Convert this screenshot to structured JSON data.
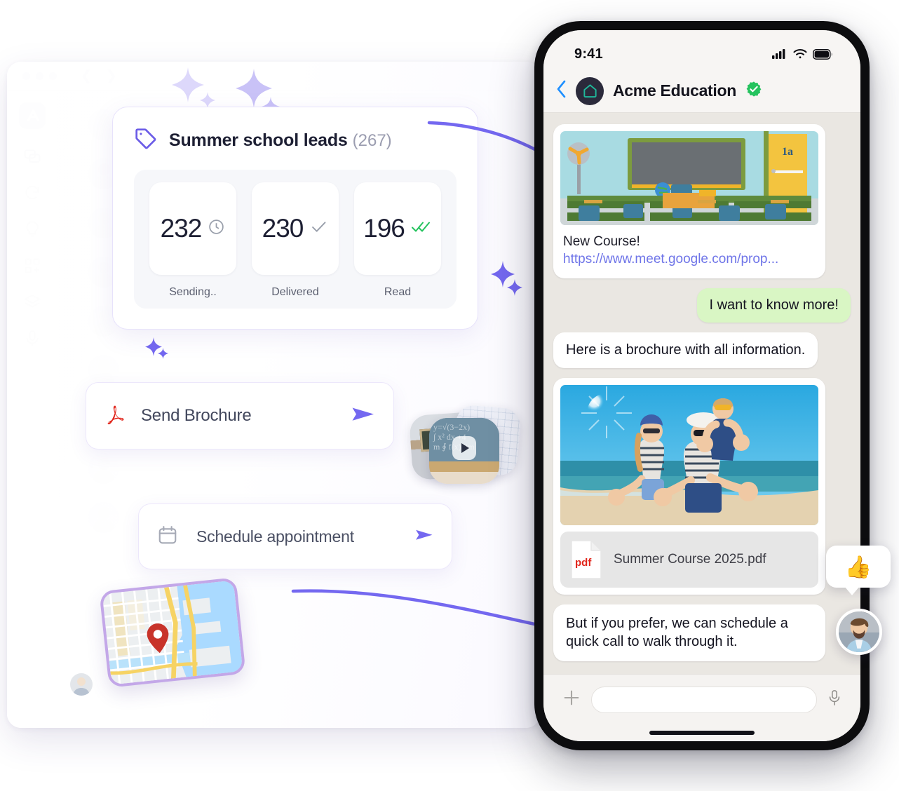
{
  "desktop": {
    "window_controls": [
      "close",
      "minimize",
      "maximize"
    ],
    "nav_back_icon": "chevron-left-icon",
    "nav_forward_icon": "chevron-right-icon",
    "rail": {
      "logo_icon": "app-logo-icon",
      "items": [
        {
          "icon": "chat-bubbles-icon",
          "name": "conversations"
        },
        {
          "icon": "refresh-sync-icon",
          "name": "sync"
        },
        {
          "icon": "lightbulb-icon",
          "name": "insights"
        },
        {
          "icon": "apps-add-icon",
          "name": "integrations"
        },
        {
          "icon": "layers-icon",
          "name": "layers"
        },
        {
          "icon": "microphone-icon",
          "name": "voice"
        }
      ]
    }
  },
  "stats_card": {
    "tag_icon": "tag-icon",
    "title": "Summer school leads",
    "count": "(267)",
    "stats": [
      {
        "value": "232",
        "label": "Sending..",
        "icon": "clock-icon",
        "icon_color": "#9aa0ac"
      },
      {
        "value": "230",
        "label": "Delivered",
        "icon": "check-icon",
        "icon_color": "#9aa0ac"
      },
      {
        "value": "196",
        "label": "Read",
        "icon": "double-check-icon",
        "icon_color": "#25c35e"
      }
    ]
  },
  "actions": [
    {
      "label": "Send Brochure",
      "icon": "adobe-pdf-icon",
      "send_icon": "send-arrow-icon"
    },
    {
      "label": "Schedule appointment",
      "icon": "calendar-icon",
      "send_icon": "send-arrow-icon"
    }
  ],
  "media_cluster": {
    "items": [
      {
        "name": "classroom-photo-thumb"
      },
      {
        "name": "blackboard-video-thumb",
        "play_icon": "play-icon"
      },
      {
        "name": "math-notes-thumb"
      }
    ]
  },
  "map_card": {
    "name": "map-location-card",
    "pin_icon": "map-pin-icon"
  },
  "phone": {
    "status": {
      "time": "9:41",
      "cellular_icon": "signal-bars-icon",
      "wifi_icon": "wifi-icon",
      "battery_icon": "battery-icon"
    },
    "header": {
      "back_icon": "chevron-left-icon",
      "avatar_icon": "home-brand-icon",
      "title": "Acme Education",
      "verified_icon": "verified-badge-icon"
    },
    "messages": [
      {
        "type": "link-card",
        "direction": "incoming",
        "image": "classroom-photo",
        "title": "New Course!",
        "link": "https://www.meet.google.com/prop..."
      },
      {
        "type": "text",
        "direction": "outgoing",
        "text": "I want to know more!"
      },
      {
        "type": "text",
        "direction": "incoming",
        "text": "Here is a brochure with all information."
      },
      {
        "type": "media-attachment",
        "direction": "incoming",
        "image": "family-beach-photo",
        "file_icon": "pdf-file-icon",
        "file_label": "pdf",
        "file_name": "Summer Course 2025.pdf"
      },
      {
        "type": "text",
        "direction": "incoming",
        "text": "But if you prefer, we can schedule a quick call to walk through it."
      }
    ],
    "input": {
      "attach_icon": "plus-icon",
      "placeholder": "",
      "value": "",
      "mic_icon": "microphone-icon"
    },
    "home_indicator": "home-indicator-bar"
  },
  "reaction": {
    "emoji": "👍",
    "avatar": "user-avatar-photo"
  },
  "colors": {
    "accent_purple": "#7468f0",
    "brand_green": "#25c35e",
    "bubble_out": "#d9f6c4",
    "link_blue": "#6e74e8",
    "pdf_red": "#e1251b"
  }
}
